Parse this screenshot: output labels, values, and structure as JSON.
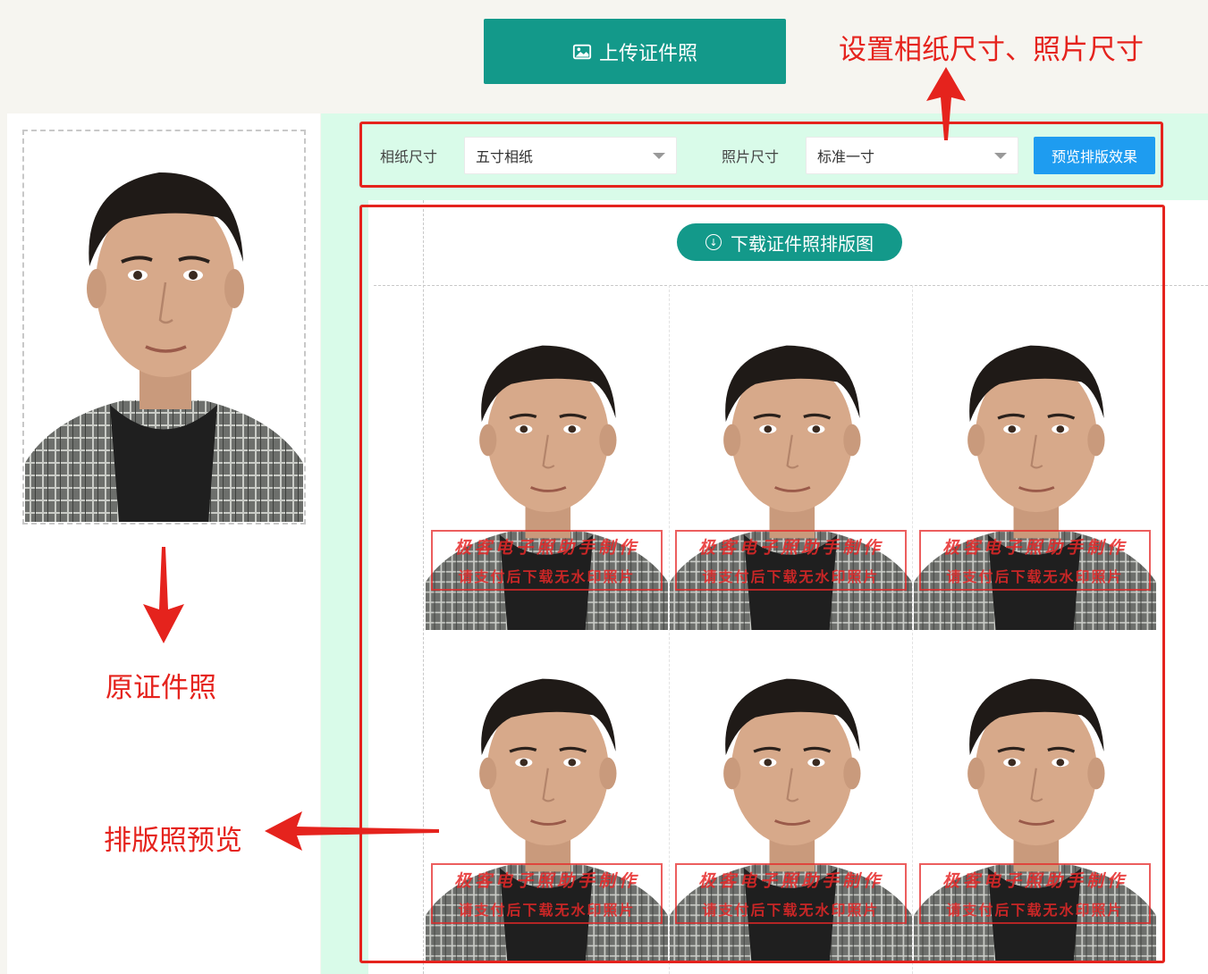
{
  "upload": {
    "label": "上传证件照",
    "icon": "image-icon"
  },
  "toolbar": {
    "paper_label": "相纸尺寸",
    "paper_value": "五寸相纸",
    "photo_label": "照片尺寸",
    "photo_value": "标准一寸",
    "preview_label": "预览排版效果"
  },
  "download": {
    "label": "下载证件照排版图",
    "icon": "download-circle-icon"
  },
  "watermark": {
    "line1": "极客电子照助手制作",
    "line2": "请支付后下载无水印照片"
  },
  "annotations": {
    "settings": "设置相纸尺寸、照片尺寸",
    "original": "原证件照",
    "layout": "排版照预览"
  },
  "layout_grid": {
    "rows": 2,
    "cols": 3
  },
  "colors": {
    "accent_teal": "#13998a",
    "preview_blue": "#1e9cf0",
    "annotation_red": "#e5231d",
    "panel_mint": "#d9fbe9"
  }
}
